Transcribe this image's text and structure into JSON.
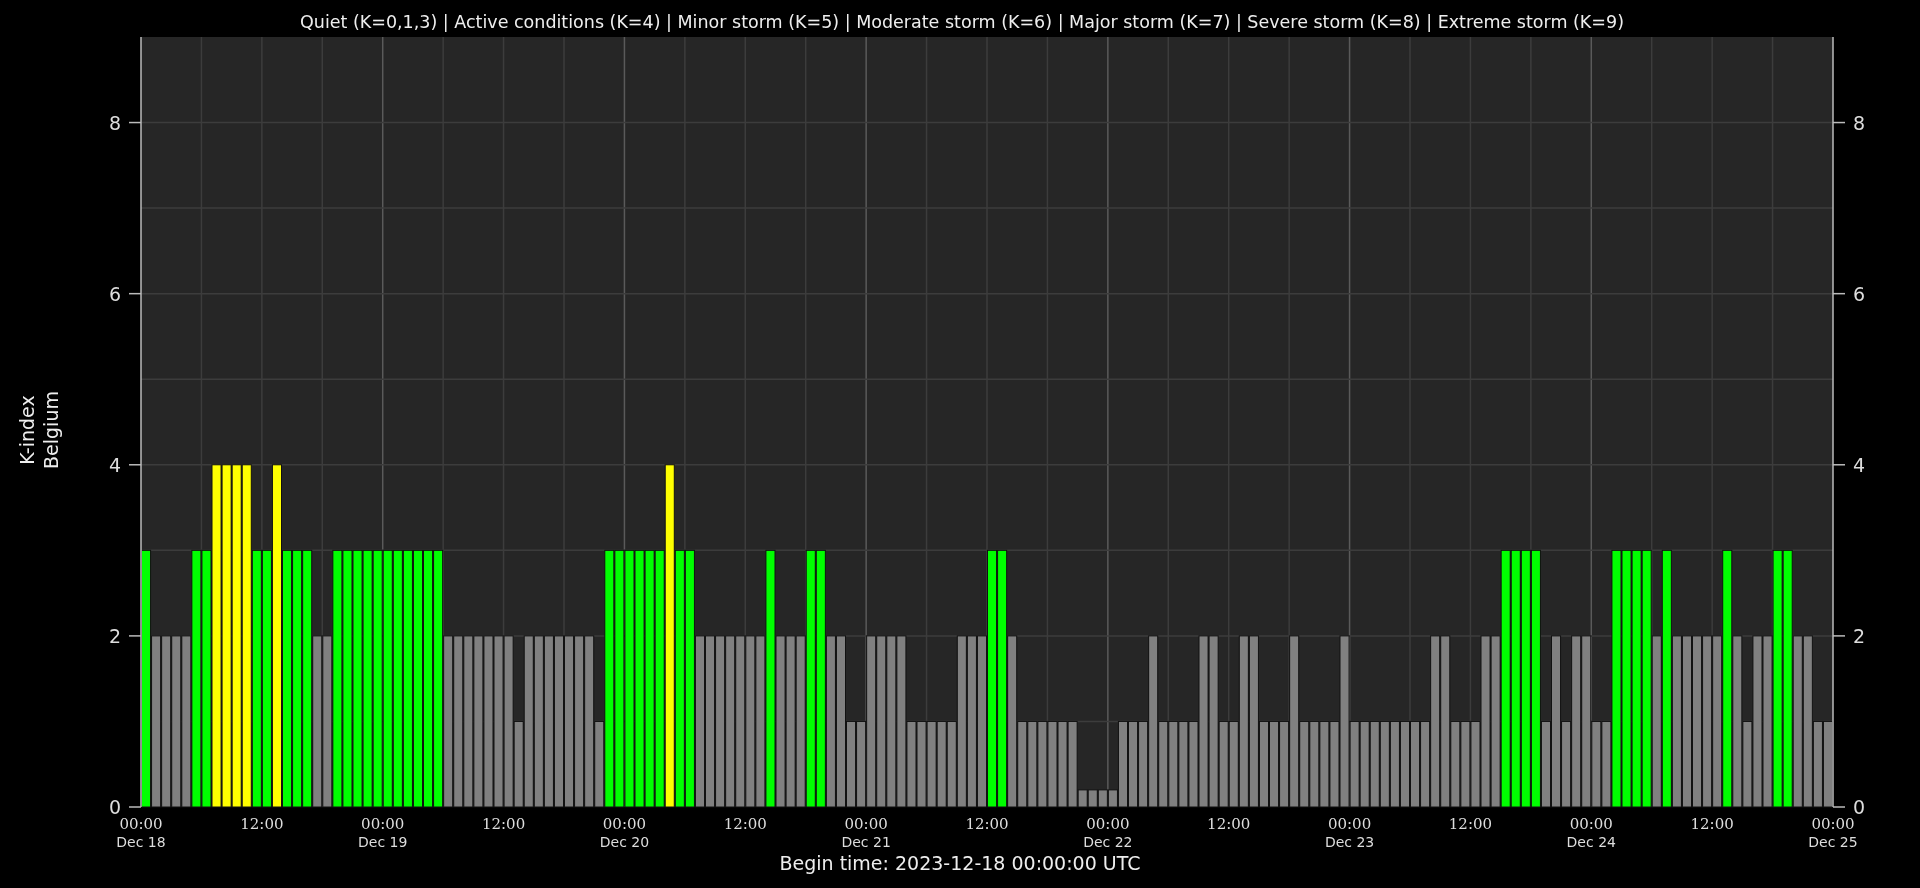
{
  "chart_data": {
    "type": "bar",
    "title": "Quiet (K=0,1,3) | Active conditions (K=4) | Minor storm (K=5) | Moderate storm (K=6) | Major storm (K=7) | Severe storm (K=8) | Extreme storm (K=9)",
    "xlabel": "Begin time: 2023-12-18 00:00:00 UTC",
    "ylabel": "K-index\nBelgium",
    "grid": true,
    "series": [
      {
        "color": "#808080",
        "values": [
          null,
          2,
          2,
          2,
          2,
          null,
          null,
          null,
          null,
          null,
          null,
          null,
          null,
          null,
          null,
          null,
          null,
          2,
          2,
          null,
          null,
          null,
          null,
          null,
          null,
          null,
          null,
          null,
          null,
          null,
          2,
          2,
          2,
          2,
          2,
          2,
          2,
          1,
          2,
          2,
          2,
          2,
          2,
          2,
          2,
          1,
          null,
          null,
          null,
          null,
          null,
          null,
          null,
          null,
          null,
          2,
          2,
          2,
          2,
          2,
          2,
          2,
          null,
          2,
          2,
          2,
          null,
          null,
          2,
          2,
          1,
          1,
          2,
          2,
          2,
          2,
          1,
          1,
          1,
          1,
          1,
          2,
          2,
          2,
          null,
          null,
          2,
          1,
          1,
          1,
          1,
          1,
          1,
          0.2,
          0.2,
          0.2,
          0.2,
          1,
          1,
          1,
          2,
          1,
          1,
          1,
          1,
          2,
          2,
          1,
          1,
          2,
          2,
          1,
          1,
          1,
          2,
          1,
          1,
          1,
          1,
          2,
          1,
          1,
          1,
          1,
          1,
          1,
          1,
          1,
          2,
          2,
          1,
          1,
          1,
          2,
          2,
          null,
          null,
          null,
          null,
          1,
          2,
          1,
          2,
          2,
          1,
          1,
          null,
          null,
          null,
          null,
          2,
          null,
          2,
          2,
          2,
          2,
          2,
          null,
          2,
          1,
          2,
          2,
          null,
          null,
          2,
          2,
          1,
          1
        ]
      },
      {
        "color": "#00ff00",
        "values": [
          3,
          null,
          null,
          null,
          null,
          3,
          3,
          null,
          null,
          null,
          null,
          3,
          3,
          null,
          3,
          3,
          3,
          null,
          null,
          3,
          3,
          3,
          3,
          3,
          3,
          3,
          3,
          3,
          3,
          3,
          null,
          null,
          null,
          null,
          null,
          null,
          null,
          null,
          null,
          null,
          null,
          null,
          null,
          null,
          null,
          null,
          3,
          3,
          3,
          3,
          3,
          3,
          null,
          3,
          3,
          null,
          null,
          null,
          null,
          null,
          null,
          null,
          3,
          null,
          null,
          null,
          3,
          3,
          null,
          null,
          null,
          null,
          null,
          null,
          null,
          null,
          null,
          null,
          null,
          null,
          null,
          null,
          null,
          null,
          3,
          3,
          null,
          null,
          null,
          null,
          null,
          null,
          null,
          null,
          null,
          null,
          null,
          null,
          null,
          null,
          null,
          null,
          null,
          null,
          null,
          null,
          null,
          null,
          null,
          null,
          null,
          null,
          null,
          null,
          null,
          null,
          null,
          null,
          null,
          null,
          null,
          null,
          null,
          null,
          null,
          null,
          null,
          null,
          null,
          null,
          null,
          null,
          null,
          null,
          null,
          3,
          3,
          3,
          3,
          null,
          null,
          null,
          null,
          null,
          null,
          null,
          3,
          3,
          3,
          3,
          null,
          3,
          null,
          null,
          null,
          null,
          null,
          3,
          null,
          null,
          null,
          null,
          3,
          3,
          null,
          null,
          null,
          null
        ]
      },
      {
        "color": "#ffff00",
        "values": [
          null,
          null,
          null,
          null,
          null,
          null,
          null,
          4,
          4,
          4,
          4,
          null,
          null,
          4,
          null,
          null,
          null,
          null,
          null,
          null,
          null,
          null,
          null,
          null,
          null,
          null,
          null,
          null,
          null,
          null,
          null,
          null,
          null,
          null,
          null,
          null,
          null,
          null,
          null,
          null,
          null,
          null,
          null,
          null,
          null,
          null,
          null,
          null,
          null,
          null,
          null,
          null,
          4,
          null,
          null,
          null,
          null,
          null,
          null,
          null,
          null,
          null,
          null,
          null,
          null,
          null,
          null,
          null,
          null,
          null,
          null,
          null,
          null,
          null,
          null,
          null,
          null,
          null,
          null,
          null,
          null,
          null,
          null,
          null,
          null,
          null,
          null,
          null,
          null,
          null,
          null,
          null,
          null,
          null,
          null,
          null,
          null,
          null,
          null,
          null,
          null,
          null,
          null,
          null,
          null,
          null,
          null,
          null,
          null,
          null,
          null,
          null,
          null,
          null,
          null,
          null,
          null,
          null,
          null,
          null,
          null,
          null,
          null,
          null,
          null,
          null,
          null,
          null,
          null,
          null,
          null,
          null,
          null,
          null,
          null,
          null,
          null,
          null,
          null,
          null,
          null,
          null,
          null,
          null,
          null,
          null,
          null,
          null,
          null,
          null,
          null,
          null,
          null,
          null,
          null,
          null,
          null,
          null,
          null,
          null,
          null,
          null,
          null,
          null,
          null,
          null,
          null,
          null
        ]
      }
    ],
    "ylim": [
      0,
      9
    ],
    "yticks": [
      0,
      2,
      4,
      6,
      8
    ],
    "annotations": [
      "0",
      "2",
      "4",
      "6",
      "8",
      "00:00\nDec 25"
    ],
    "categories": [
      "00:00\nDec 18",
      null,
      null,
      null,
      null,
      null,
      null,
      null,
      null,
      null,
      null,
      null,
      "12:00",
      null,
      null,
      null,
      null,
      null,
      null,
      null,
      null,
      null,
      null,
      null,
      "00:00\nDec 19",
      null,
      null,
      null,
      null,
      null,
      null,
      null,
      null,
      null,
      null,
      null,
      "12:00",
      null,
      null,
      null,
      null,
      null,
      null,
      null,
      null,
      null,
      null,
      null,
      "00:00\nDec 20",
      null,
      null,
      null,
      null,
      null,
      null,
      null,
      null,
      null,
      null,
      null,
      "12:00",
      null,
      null,
      null,
      null,
      null,
      null,
      null,
      null,
      null,
      null,
      null,
      "00:00\nDec 21",
      null,
      null,
      null,
      null,
      null,
      null,
      null,
      null,
      null,
      null,
      null,
      "12:00",
      null,
      null,
      null,
      null,
      null,
      null,
      null,
      null,
      null,
      null,
      null,
      "00:00\nDec 22",
      null,
      null,
      null,
      null,
      null,
      null,
      null,
      null,
      null,
      null,
      null,
      "12:00",
      null,
      null,
      null,
      null,
      null,
      null,
      null,
      null,
      null,
      null,
      null,
      "00:00\nDec 23",
      null,
      null,
      null,
      null,
      null,
      null,
      null,
      null,
      null,
      null,
      null,
      "12:00",
      null,
      null,
      null,
      null,
      null,
      null,
      null,
      null,
      null,
      null,
      null,
      "00:00\nDec 24",
      null,
      null,
      null,
      null,
      null,
      null,
      null,
      null,
      null,
      null,
      null,
      "12:00",
      null,
      null,
      null,
      null,
      null,
      null,
      null,
      null,
      null,
      null,
      null
    ]
  }
}
